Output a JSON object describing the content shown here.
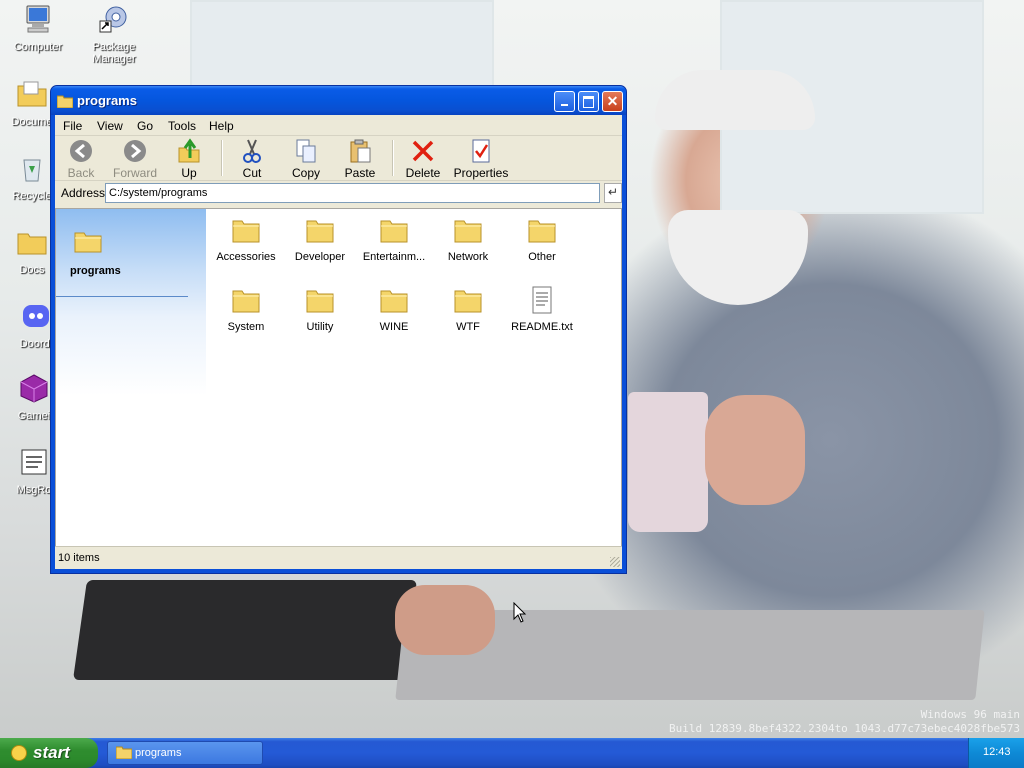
{
  "desktop": {
    "icons": [
      {
        "label": "Computer"
      },
      {
        "label": "Package Manager"
      },
      {
        "label": "Docume"
      },
      {
        "label": "Recycle"
      },
      {
        "label": "Docs"
      },
      {
        "label": "Doordi"
      },
      {
        "label": "Gamei"
      },
      {
        "label": "MsgRo"
      }
    ],
    "build_line1": "Windows 96 main",
    "build_line2": "Build 12839.8bef4322.2304to 1043.d77c73ebec4028fbe573"
  },
  "window": {
    "title": "programs",
    "menu": [
      "File",
      "View",
      "Go",
      "Tools",
      "Help"
    ],
    "toolbar": {
      "back": "Back",
      "forward": "Forward",
      "up": "Up",
      "cut": "Cut",
      "copy": "Copy",
      "paste": "Paste",
      "delete": "Delete",
      "properties": "Properties"
    },
    "address_label": "Address",
    "address_value": "C:/system/programs",
    "side_title": "programs",
    "items": [
      {
        "name": "Accessories",
        "type": "folder"
      },
      {
        "name": "Developer",
        "type": "folder"
      },
      {
        "name": "Entertainm...",
        "type": "folder"
      },
      {
        "name": "Network",
        "type": "folder"
      },
      {
        "name": "Other",
        "type": "folder"
      },
      {
        "name": "System",
        "type": "folder"
      },
      {
        "name": "Utility",
        "type": "folder"
      },
      {
        "name": "WINE",
        "type": "folder"
      },
      {
        "name": "WTF",
        "type": "folder"
      },
      {
        "name": "README.txt",
        "type": "text-file"
      }
    ],
    "status": "10 items"
  },
  "taskbar": {
    "start_label": "start",
    "task_label": "programs",
    "clock": "12:43"
  }
}
